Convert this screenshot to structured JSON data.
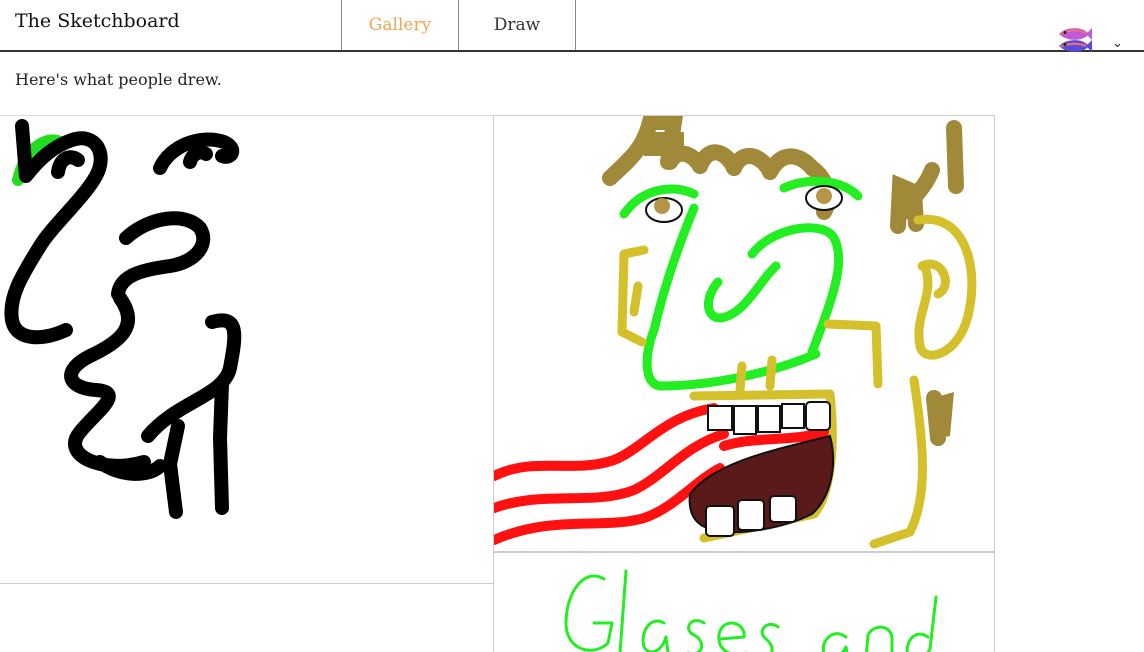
{
  "header": {
    "brand": "The Sketchboard",
    "tabs": [
      {
        "label": "Gallery",
        "active": true,
        "color": "#f2a35a"
      },
      {
        "label": "Draw",
        "active": false
      }
    ],
    "user_avatar_icon": "fish-pair-icon",
    "menu_icon": "chevron-down-icon"
  },
  "main": {
    "intro": "Here's what people drew.",
    "gallery": [
      {
        "name": "drawing-black-scribble-face",
        "colors": [
          "#000000",
          "#22dd22"
        ]
      },
      {
        "name": "drawing-big-nose-face",
        "colors": [
          "#a08a3a",
          "#22ee22",
          "#d4c02a",
          "#ff1111",
          "#5a1a1a",
          "#ffffff"
        ]
      },
      {
        "name": "drawing-handwritten-text",
        "text": "Glases and",
        "color": "#22ee22"
      }
    ]
  }
}
